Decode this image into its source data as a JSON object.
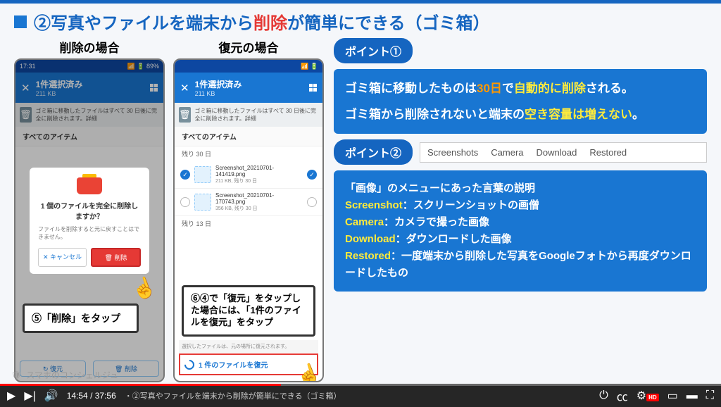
{
  "title": {
    "prefix": "②写真やファイルを端末から",
    "highlight": "削除",
    "suffix": "が簡単にできる（ゴミ箱）"
  },
  "phones": {
    "delete": {
      "label": "削除の場合",
      "time": "17:31",
      "battery": "89%",
      "header_title": "1件選択済み",
      "header_sub": "211 KB",
      "info": "ゴミ箱に移動したファイルはすべて 30 日後に完全に削除されます。詳細",
      "section": "すべてのアイテム",
      "dialog": {
        "title": "1 個のファイルを完全に削除しますか？",
        "body": "ファイルを削除すると元に戻すことはできません。",
        "cancel": "✕ キャンセル",
        "delete": "🗑 削除"
      },
      "callout": "⑤「削除」をタップ",
      "bottom_restore": "↻ 復元",
      "bottom_delete": "🗑 削除"
    },
    "restore": {
      "label": "復元の場合",
      "header_title": "1件選択済み",
      "header_sub": "211 KB",
      "info": "ゴミ箱に移動したファイルはすべて 30 日後に完全に削除されます。詳細",
      "section": "すべてのアイテム",
      "group1": "残り 30 日",
      "file1_name": "Screenshot_20210701-141419.png",
      "file1_meta": "211 KB, 残り 30 日",
      "file2_name": "Screenshot_20210701-170743.png",
      "file2_meta": "356 KB, 残り 30 日",
      "group2": "残り 13 日",
      "callout": "⑥④で「復元」をタップした場合には、「1件のファイルを復元」をタップ",
      "restore_info": "選択したファイルは、元の場所に復元されます。",
      "restore_btn": "1 件のファイルを復元"
    }
  },
  "points": {
    "p1_badge": "ポイント①",
    "p1_line1a": "ゴミ箱に移動したものは",
    "p1_line1b": "30日",
    "p1_line1c": "で",
    "p1_line1d": "自動的に削除",
    "p1_line1e": "される。",
    "p1_line2a": "ゴミ箱から削除されないと端末の",
    "p1_line2b": "空き容量は増えない",
    "p1_line2c": "。",
    "p2_badge": "ポイント②",
    "menu_items": [
      "Screenshots",
      "Camera",
      "Download",
      "Restored"
    ],
    "p2_title": "「画像」のメニューにあった言葉の説明",
    "p2_ss_k": "Screenshot",
    "p2_ss_v": "：スクリーンショットの画僧",
    "p2_cam_k": "Camera",
    "p2_cam_v": "：カメラで撮った画像",
    "p2_dl_k": "Download",
    "p2_dl_v": "：ダウンロードした画像",
    "p2_re_k": "Restored",
    "p2_re_v": "：一度端末から削除した写真をGoogleフォトから再度ダウンロードしたもの"
  },
  "video": {
    "current": "14:54",
    "total": "37:56",
    "chapter": "・②写真やファイルを端末から削除が簡単にできる（ゴミ箱）",
    "hd": "HD",
    "channel": "スマホのコンシェルジュ"
  }
}
